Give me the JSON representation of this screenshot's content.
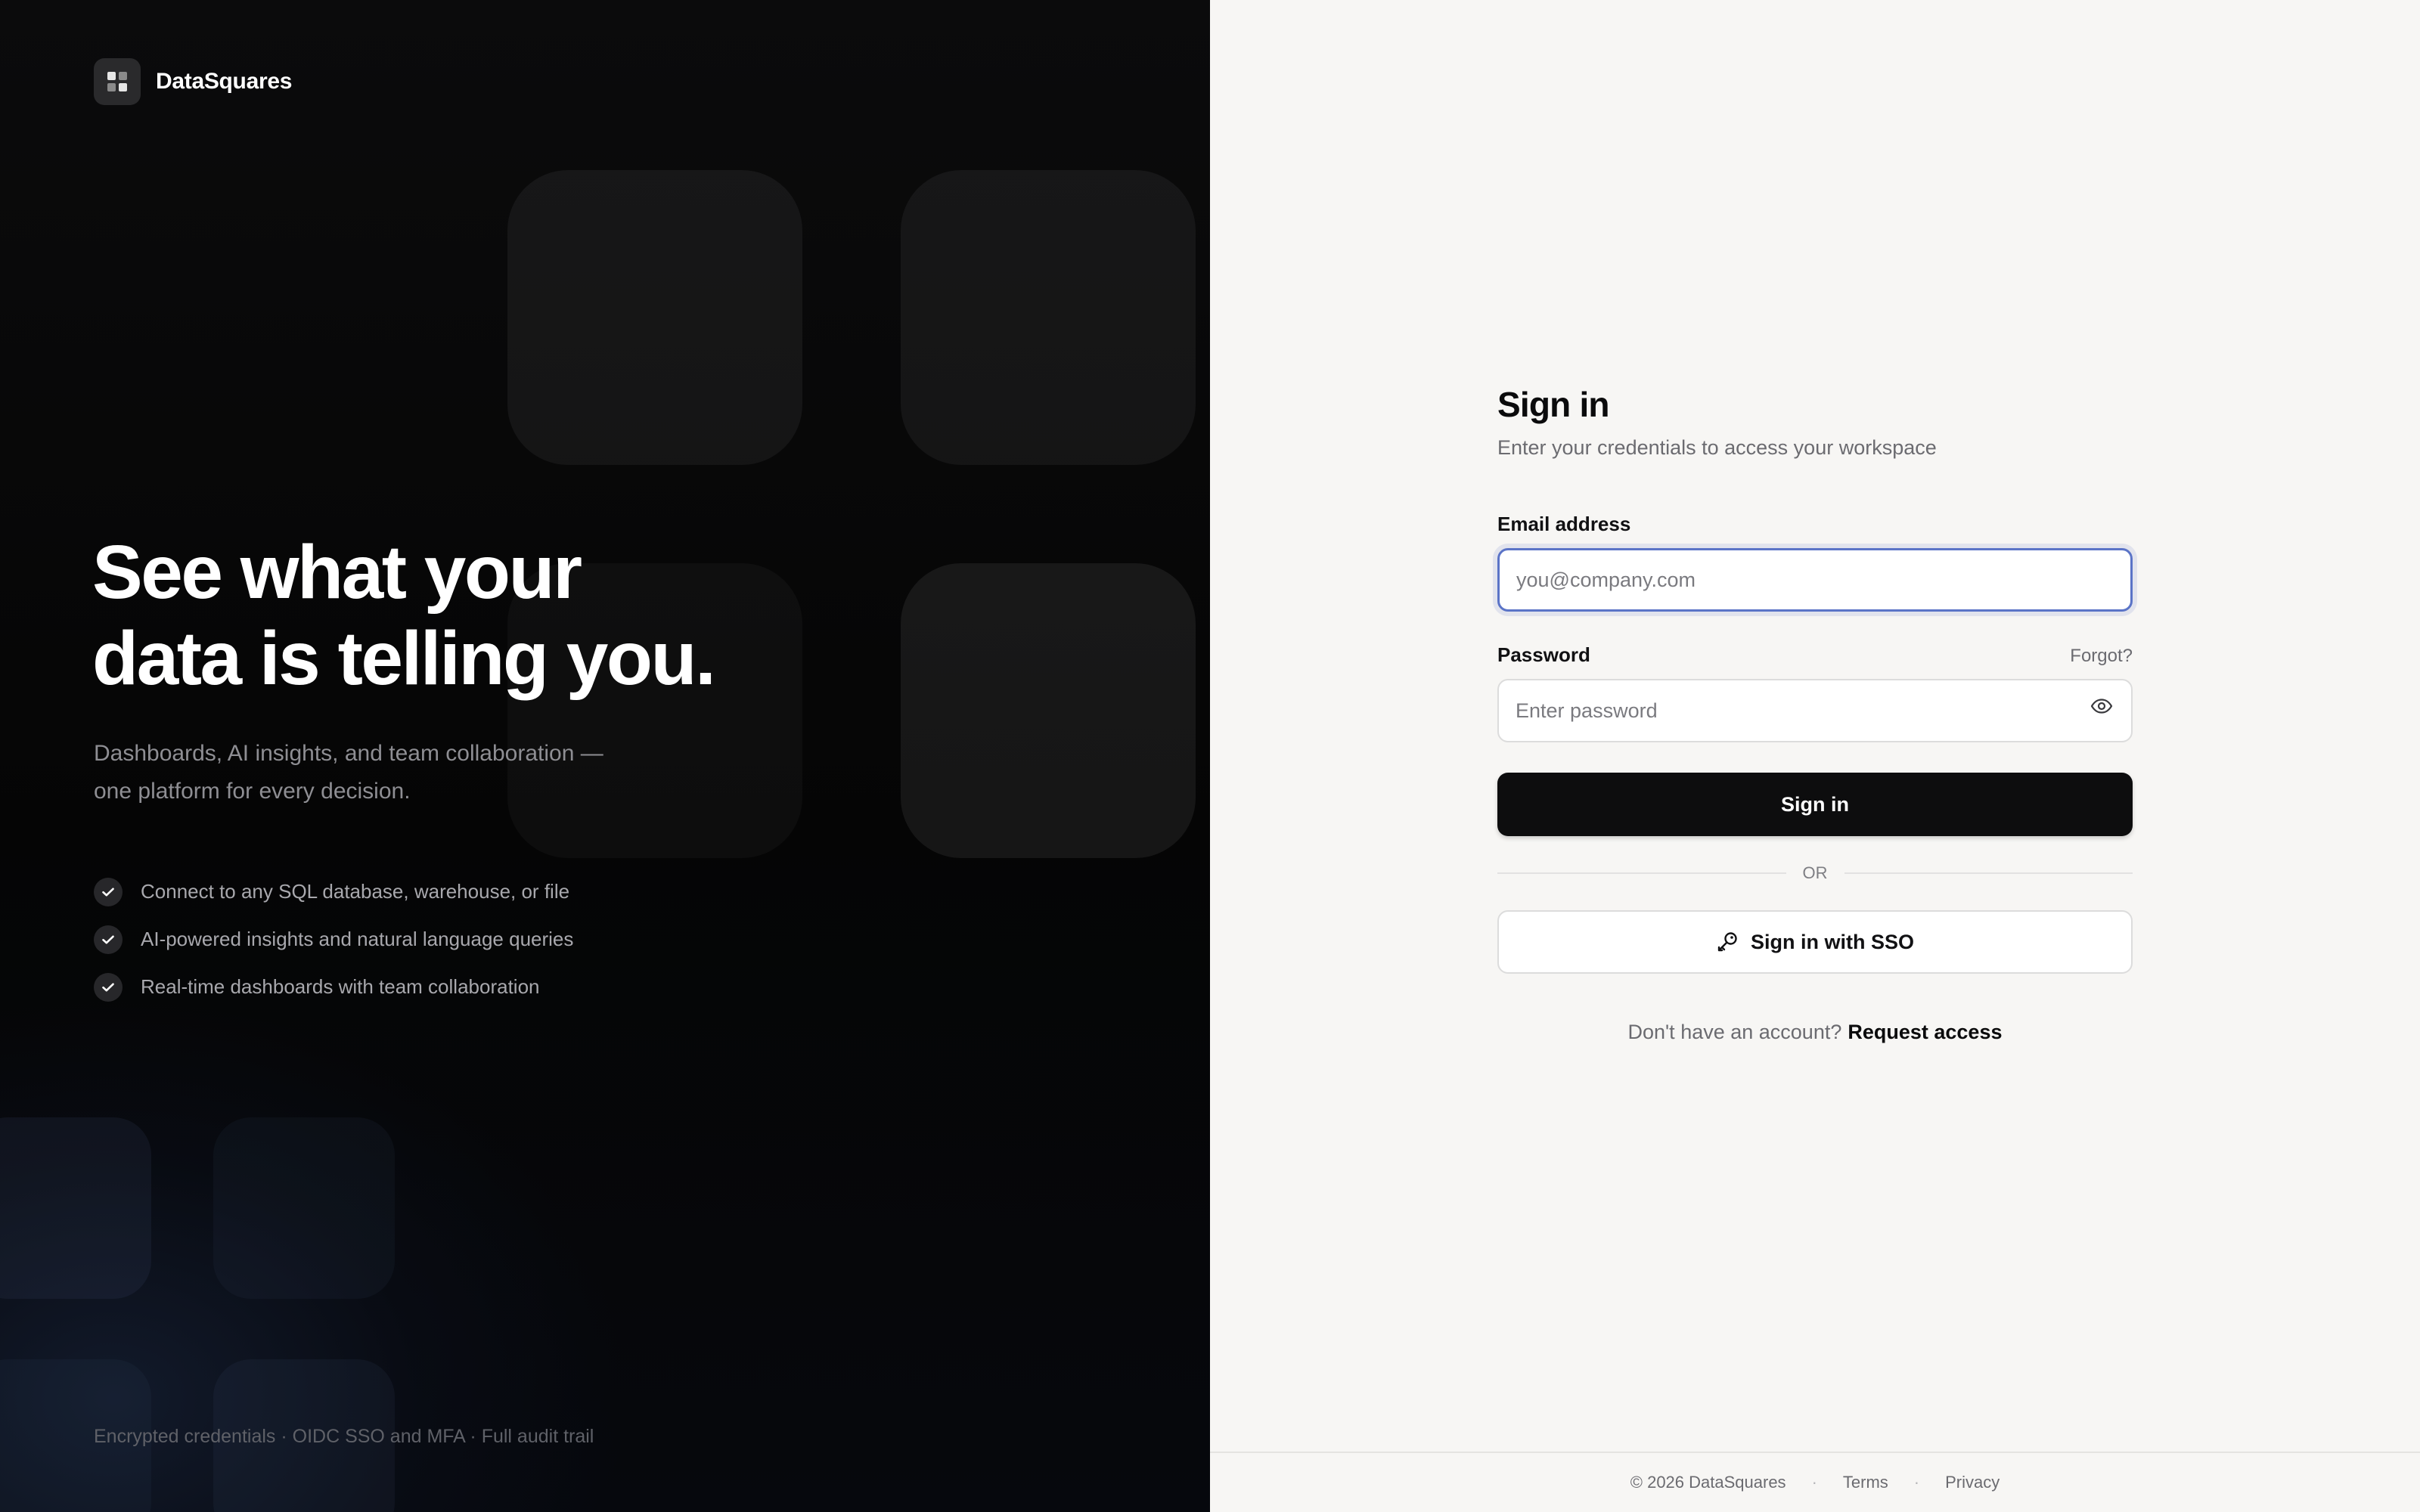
{
  "brand": {
    "name": "DataSquares",
    "logo_colors": [
      "#e6e6e6",
      "#8a8a8a",
      "#8a8a8a",
      "#e6e6e6"
    ]
  },
  "hero": {
    "title_line1": "See what your",
    "title_line2": "data is telling you.",
    "subtitle_line1": "Dashboards, AI insights, and team collaboration —",
    "subtitle_line2": "one platform for every decision."
  },
  "features": [
    {
      "text": "Connect to any SQL database, warehouse, or file",
      "icon": "check-icon"
    },
    {
      "text": "AI-powered insights and natural language queries",
      "icon": "check-icon"
    },
    {
      "text": "Real-time dashboards with team collaboration",
      "icon": "check-icon"
    }
  ],
  "trust_line": "Encrypted credentials · OIDC SSO and MFA · Full audit trail",
  "form": {
    "title": "Sign in",
    "subtitle": "Enter your credentials to access your workspace",
    "email_label": "Email address",
    "email_value": "",
    "email_placeholder": "you@company.com",
    "password_label": "Password",
    "forgot_label": "Forgot?",
    "password_value": "",
    "password_placeholder": "Enter password",
    "password_toggle_icon": "eye-icon",
    "signin_label": "Sign in",
    "divider_label": "OR",
    "sso_label": "Sign in with SSO",
    "sso_icon": "key-icon",
    "no_account_text": "Don't have an account?",
    "request_access_label": "Request access"
  },
  "footer": {
    "copyright": "© 2026 DataSquares",
    "terms_label": "Terms",
    "privacy_label": "Privacy",
    "separator": "·"
  },
  "colors": {
    "focus_ring": "#5b74c7",
    "primary_button": "#0d0d0e",
    "right_background": "#f7f6f4"
  }
}
